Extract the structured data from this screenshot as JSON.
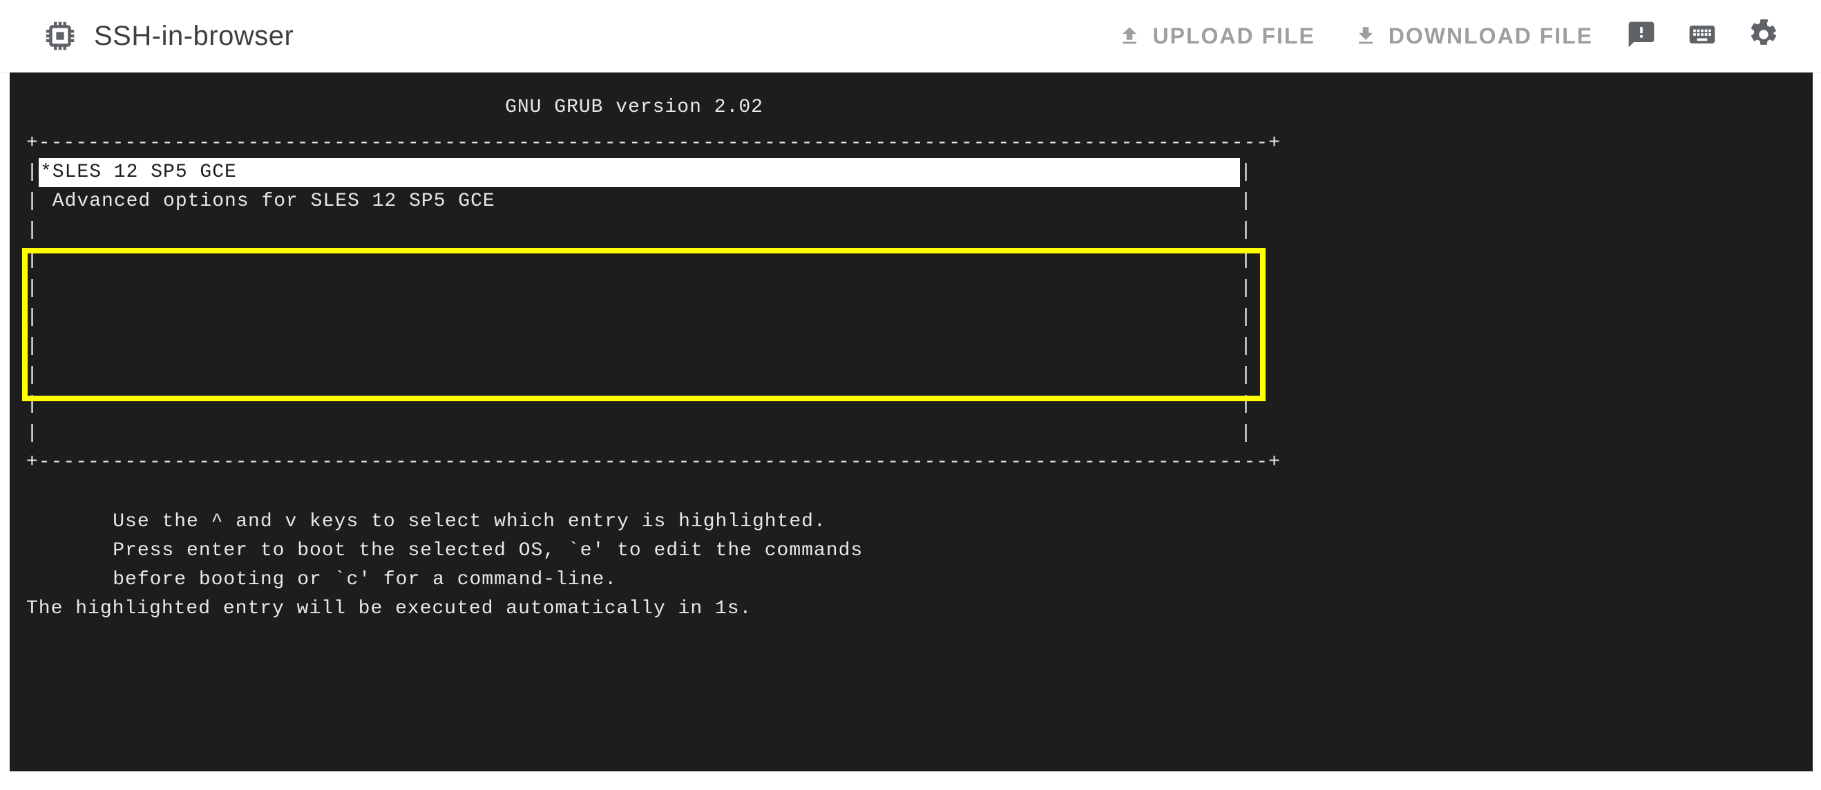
{
  "header": {
    "title": "SSH-in-browser",
    "upload_label": "UPLOAD FILE",
    "download_label": "DOWNLOAD FILE"
  },
  "icons": {
    "chip": "chip-icon",
    "upload": "upload-icon",
    "download": "download-icon",
    "feedback": "feedback-icon",
    "keyboard": "keyboard-icon",
    "settings": "settings-gear-icon"
  },
  "grub": {
    "title": "GNU GRUB  version 2.02",
    "border_top": "+----------------------------------------------------------------------------------------------------+",
    "border_bottom": "+----------------------------------------------------------------------------------------------------+",
    "side_char": "|",
    "entries": [
      {
        "text": "*SLES 12 SP5 GCE",
        "selected": true
      },
      {
        "text": " Advanced options for SLES 12 SP5 GCE",
        "selected": false
      }
    ],
    "blank_rows": 8,
    "hints": [
      "    Use the ^ and v keys to select which entry is highlighted.",
      "    Press enter to boot the selected OS, `e' to edit the commands",
      "    before booting or `c' for a command-line.",
      "The highlighted entry will be executed automatically in 1s."
    ]
  },
  "colors": {
    "terminal_bg": "#1d1d1d",
    "terminal_fg": "#e8e8e8",
    "highlight": "#ffff00",
    "toolbar_text": "#9e9e9e"
  }
}
